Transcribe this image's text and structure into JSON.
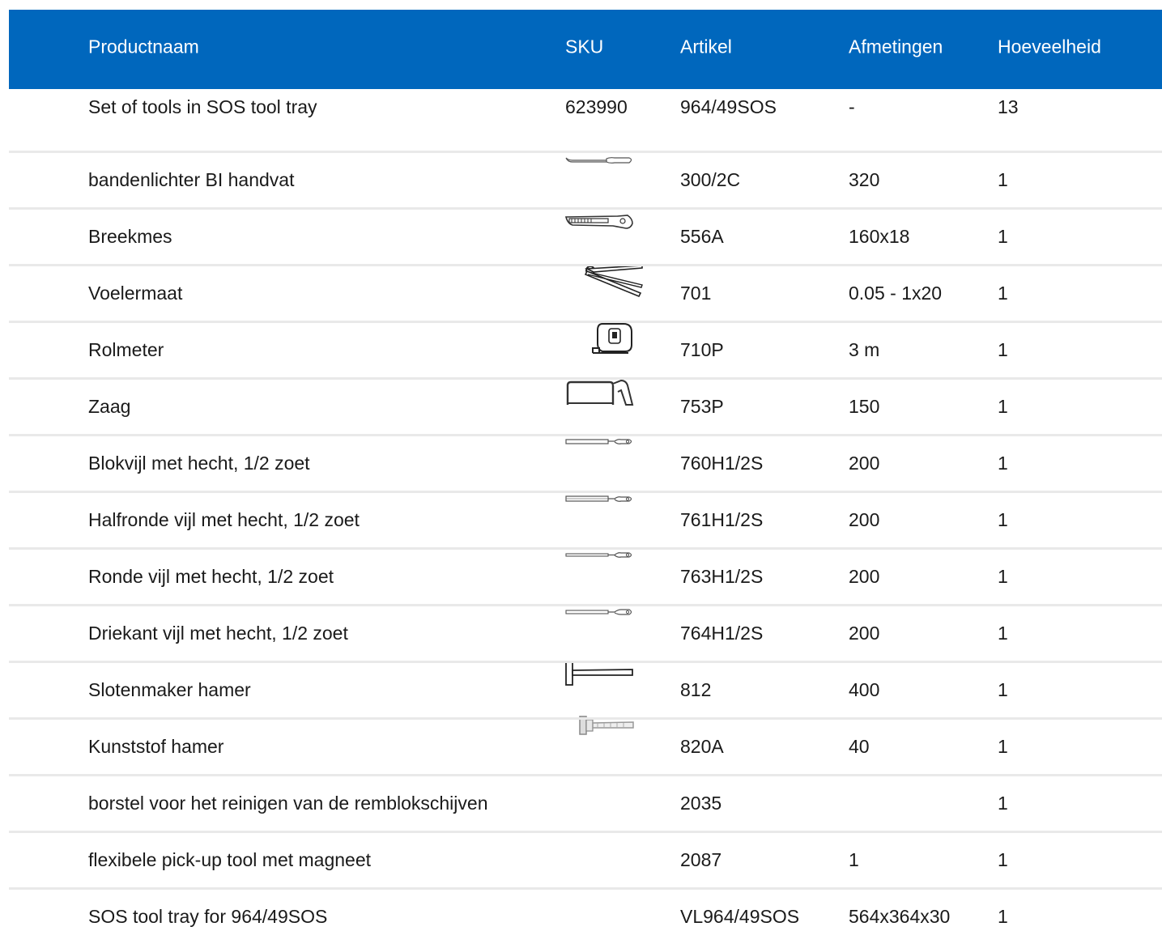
{
  "header": {
    "name": "Productnaam",
    "sku": "SKU",
    "artikel": "Artikel",
    "afmetingen": "Afmetingen",
    "hoeveelheid": "Hoeveelheid"
  },
  "rows": [
    {
      "name": "Set of tools in SOS tool tray",
      "sku": "623990",
      "artikel": "964/49SOS",
      "afmetingen": "-",
      "hoeveelheid": "13",
      "image": "none"
    },
    {
      "name": "bandenlichter BI handvat",
      "sku": "",
      "artikel": "300/2C",
      "afmetingen": "320",
      "hoeveelheid": "1",
      "image": "tire-lever-icon"
    },
    {
      "name": "Breekmes",
      "sku": "",
      "artikel": "556A",
      "afmetingen": "160x18",
      "hoeveelheid": "1",
      "image": "utility-knife-icon"
    },
    {
      "name": "Voelermaat",
      "sku": "",
      "artikel": "701",
      "afmetingen": "0.05 - 1x20",
      "hoeveelheid": "1",
      "image": "feeler-gauge-icon"
    },
    {
      "name": "Rolmeter",
      "sku": "",
      "artikel": "710P",
      "afmetingen": "3 m",
      "hoeveelheid": "1",
      "image": "tape-measure-icon"
    },
    {
      "name": "Zaag",
      "sku": "",
      "artikel": "753P",
      "afmetingen": "150",
      "hoeveelheid": "1",
      "image": "hacksaw-icon"
    },
    {
      "name": "Blokvijl met hecht, 1/2 zoet",
      "sku": "",
      "artikel": "760H1/2S",
      "afmetingen": "200",
      "hoeveelheid": "1",
      "image": "flat-file-icon"
    },
    {
      "name": "Halfronde vijl met hecht, 1/2 zoet",
      "sku": "",
      "artikel": "761H1/2S",
      "afmetingen": "200",
      "hoeveelheid": "1",
      "image": "half-round-file-icon"
    },
    {
      "name": "Ronde vijl met hecht, 1/2 zoet",
      "sku": "",
      "artikel": "763H1/2S",
      "afmetingen": "200",
      "hoeveelheid": "1",
      "image": "round-file-icon"
    },
    {
      "name": "Driekant vijl met hecht, 1/2 zoet",
      "sku": "",
      "artikel": "764H1/2S",
      "afmetingen": "200",
      "hoeveelheid": "1",
      "image": "triangular-file-icon"
    },
    {
      "name": "Slotenmaker hamer",
      "sku": "",
      "artikel": "812",
      "afmetingen": "400",
      "hoeveelheid": "1",
      "image": "hammer-icon"
    },
    {
      "name": "Kunststof hamer",
      "sku": "",
      "artikel": "820A",
      "afmetingen": "40",
      "hoeveelheid": "1",
      "image": "plastic-hammer-icon"
    },
    {
      "name": "borstel voor het reinigen van de remblokschijven",
      "sku": "",
      "artikel": "2035",
      "afmetingen": "",
      "hoeveelheid": "1",
      "image": "none"
    },
    {
      "name": "flexibele pick-up tool met magneet",
      "sku": "",
      "artikel": "2087",
      "afmetingen": "1",
      "hoeveelheid": "1",
      "image": "none"
    },
    {
      "name": "SOS tool tray for 964/49SOS",
      "sku": "",
      "artikel": "VL964/49SOS",
      "afmetingen": "564x364x30",
      "hoeveelheid": "1",
      "image": "none"
    }
  ],
  "colors": {
    "header_bg": "#0067bd",
    "header_text": "#ffffff",
    "separator": "#e9e9e9",
    "text": "#1a1a1a"
  }
}
